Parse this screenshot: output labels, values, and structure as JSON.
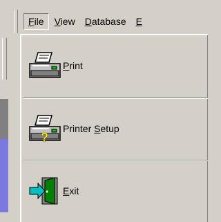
{
  "menubar": {
    "items": [
      {
        "pre": "",
        "key": "F",
        "post": "ile"
      },
      {
        "pre": "",
        "key": "V",
        "post": "iew"
      },
      {
        "pre": "",
        "key": "D",
        "post": "atabase"
      },
      {
        "pre": "",
        "key": "E",
        "post": ""
      }
    ]
  },
  "dropdown": {
    "items": [
      {
        "pre": "",
        "key": "P",
        "post": "rint",
        "icon": "printer-icon"
      },
      {
        "pre": "Printer ",
        "key": "S",
        "post": "etup",
        "icon": "printer-setup-icon"
      },
      {
        "pre": "",
        "key": "E",
        "post": "xit",
        "icon": "exit-door-icon"
      }
    ]
  }
}
